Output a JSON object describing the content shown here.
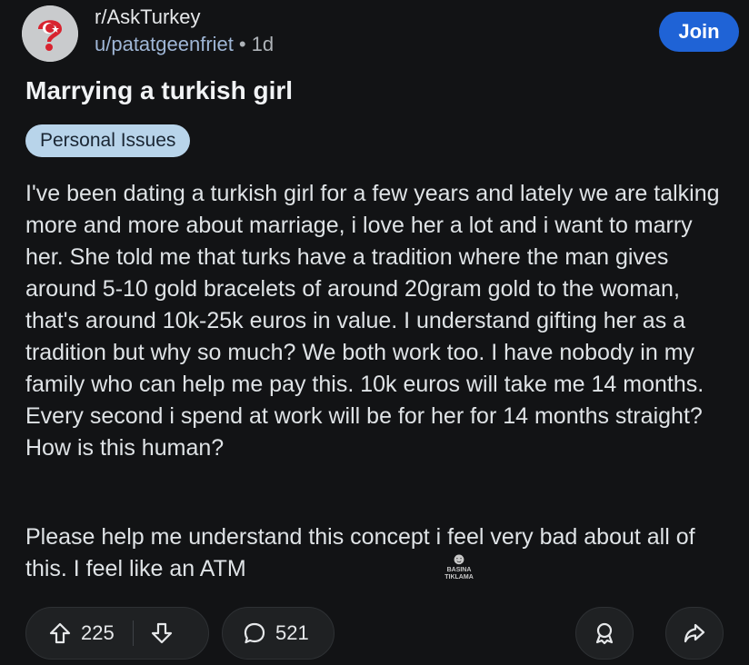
{
  "header": {
    "subreddit": "r/AskTurkey",
    "author": "u/patatgeenfriet",
    "separator": "•",
    "age": "1d",
    "join_label": "Join"
  },
  "post": {
    "title": "Marrying a turkish girl",
    "flair": "Personal Issues",
    "paragraphs": [
      "I've been dating a turkish girl for a few years and lately we are talking more and more about marriage, i love her a lot and i want to marry her. She told me that turks have a tradition where the man gives around 5-10 gold bracelets of around 20gram gold to the woman, that's around 10k-25k euros in value. I understand gifting her as a tradition but why so much? We both work too. I have nobody in my family who can help me pay this. 10k euros will take me 14 months. Every second i spend at work will be for her for 14 months straight? How is this human?",
      "Please help me understand this concept i feel very bad about all of this. I feel like an ATM"
    ],
    "watermark_line1": "BASINA",
    "watermark_line2": "TIKLAMA"
  },
  "actions": {
    "upvotes": "225",
    "comments": "521"
  },
  "colors": {
    "background": "#121315",
    "join_button": "#1f63d6",
    "flair_bg": "#b8d4ea",
    "meta_link": "#9fb6d6"
  },
  "icons": {
    "avatar": "turkey-flag-question-avatar",
    "upvote": "arrow-up-icon",
    "downvote": "arrow-down-icon",
    "comment": "comment-bubble-icon",
    "award": "award-icon",
    "share": "share-arrow-icon"
  }
}
